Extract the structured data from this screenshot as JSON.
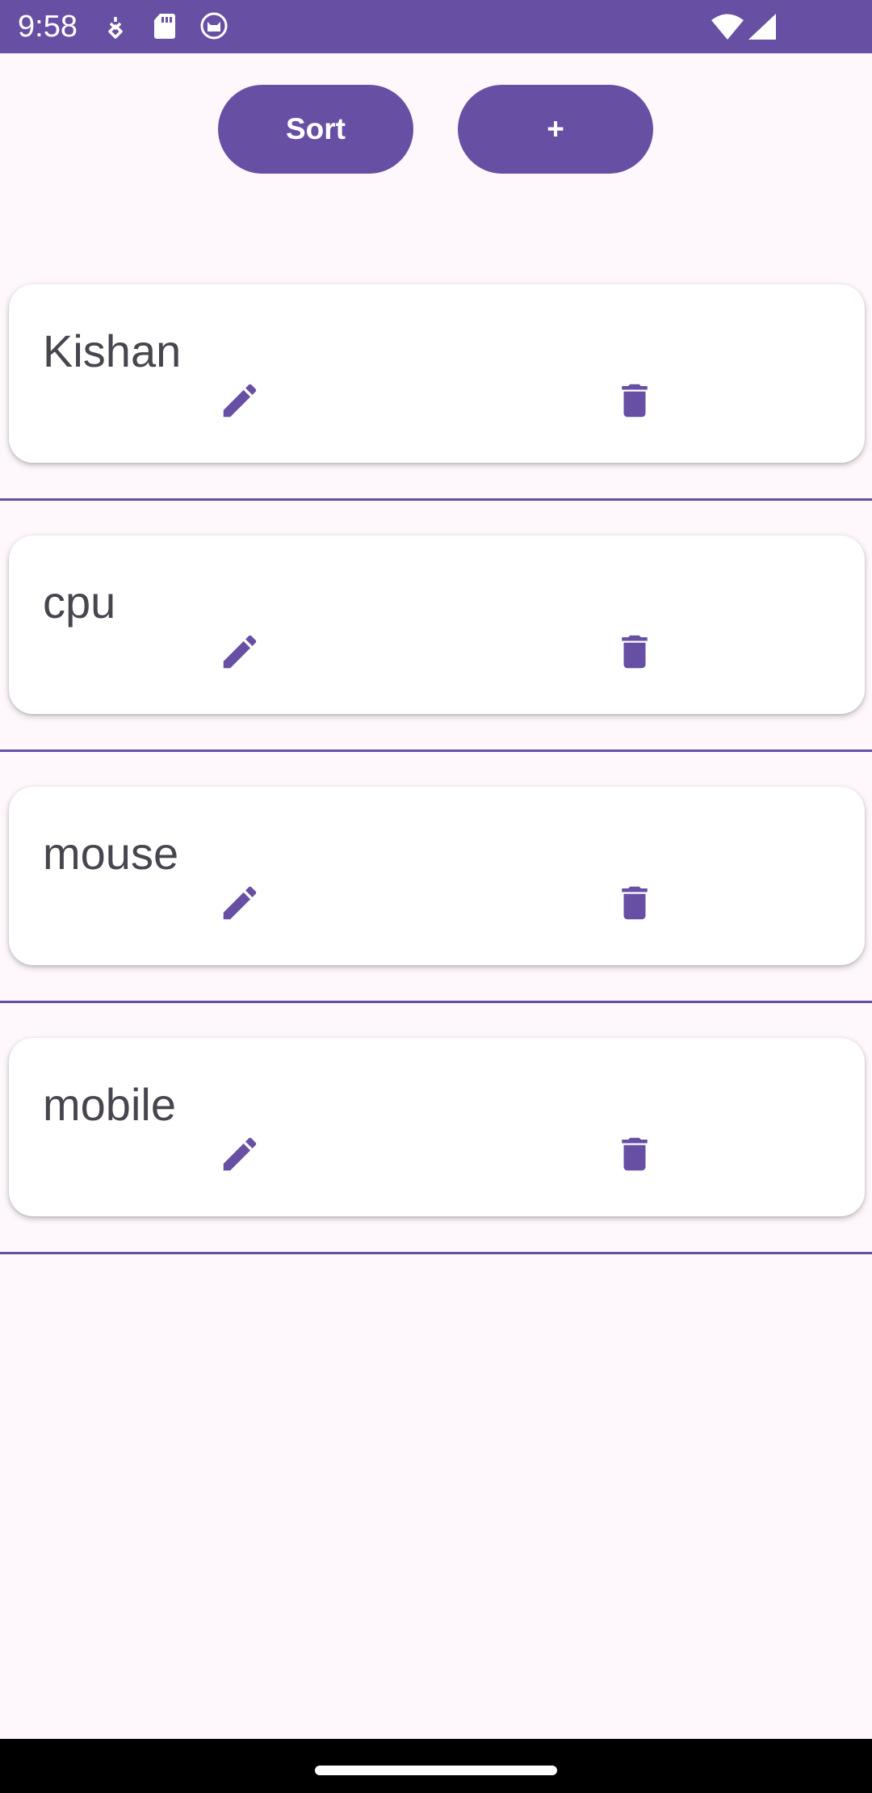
{
  "status_bar": {
    "time": "9:58",
    "left_icons": [
      "gesture-icon",
      "sd-card-icon",
      "cat-icon"
    ],
    "right_icons": [
      "wifi-icon",
      "signal-icon"
    ]
  },
  "toolbar": {
    "sort_label": "Sort",
    "add_label": "+"
  },
  "items": [
    {
      "name": "Kishan"
    },
    {
      "name": "cpu"
    },
    {
      "name": "mouse"
    },
    {
      "name": "mobile"
    }
  ],
  "colors": {
    "primary": "#6750a4",
    "background": "#fef7fc",
    "card": "#ffffff",
    "text": "#49454f"
  }
}
